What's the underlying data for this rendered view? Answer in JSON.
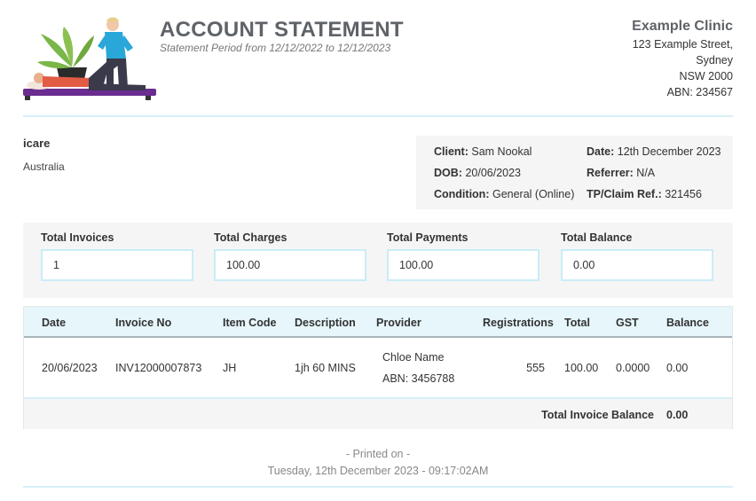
{
  "header": {
    "title": "ACCOUNT STATEMENT",
    "period": "Statement Period from 12/12/2022 to 12/12/2023",
    "logo_icon": "physiotherapy-illustration"
  },
  "clinic": {
    "name": "Example Clinic",
    "street": "123 Example Street,",
    "city": "Sydney",
    "state": "NSW 2000",
    "abn": "ABN: 234567"
  },
  "payer": {
    "name": "icare",
    "country": "Australia"
  },
  "details": {
    "client_label": "Client:",
    "client_value": "Sam Nookal",
    "date_label": "Date:",
    "date_value": "12th December 2023",
    "dob_label": "DOB:",
    "dob_value": "20/06/2023",
    "referrer_label": "Referrer:",
    "referrer_value": "N/A",
    "condition_label": "Condition:",
    "condition_value": "General (Online)",
    "claim_label": "TP/Claim Ref.:",
    "claim_value": "321456"
  },
  "totals": [
    {
      "label": "Total Invoices",
      "value": "1"
    },
    {
      "label": "Total Charges",
      "value": "100.00"
    },
    {
      "label": "Total Payments",
      "value": "100.00"
    },
    {
      "label": "Total Balance",
      "value": "0.00"
    }
  ],
  "table": {
    "headers": {
      "date": "Date",
      "invoice": "Invoice No",
      "item": "Item Code",
      "description": "Description",
      "provider": "Provider",
      "registrations": "Registrations",
      "total": "Total",
      "gst": "GST",
      "balance": "Balance"
    },
    "rows": [
      {
        "date": "20/06/2023",
        "invoice": "INV12000007873",
        "item": "JH",
        "description": "1jh 60 MINS",
        "provider_name": "Chloe Name",
        "provider_abn": "ABN: 3456788",
        "registrations": "555",
        "total": "100.00",
        "gst": "0.0000",
        "balance": "0.00"
      }
    ],
    "footer_label": "Total Invoice Balance",
    "footer_value": "0.00"
  },
  "printed": {
    "label": "- Printed on -",
    "timestamp": "Tuesday, 12th December 2023 - 09:17:02AM"
  },
  "colors": {
    "accent_light": "#e6f6fb",
    "box_border": "#c9edf6",
    "title_gray": "#5f6368",
    "panel_bg": "#f5f5f5"
  }
}
